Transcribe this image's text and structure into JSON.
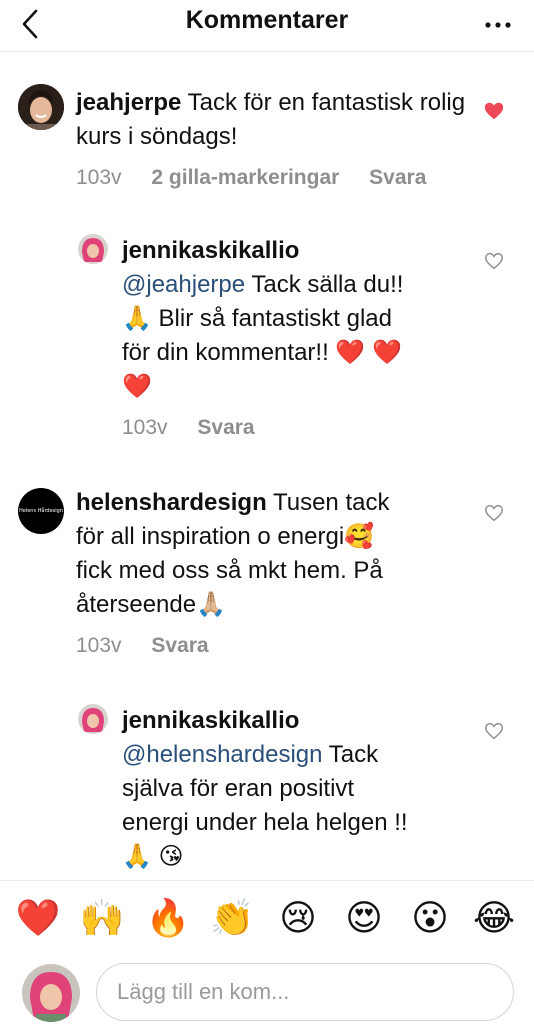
{
  "header": {
    "title": "Kommentarer",
    "back_icon": "chevron-left-icon",
    "more_icon": "more-horizontal-icon"
  },
  "comments": [
    {
      "username": "jeahjerpe",
      "text": "Tack för en fantastisk rolig kurs i söndags!",
      "age": "103v",
      "likes": "2 gilla-markeringar",
      "reply": "Svara",
      "liked": true
    },
    {
      "username": "jennikaskikallio",
      "mention": "@jeahjerpe",
      "text_line1": "Tack sälla du!!",
      "text_line2": "🙏 Blir så fantastiskt glad",
      "text_line3": "för din kommentar!! ❤️ ❤️",
      "text_line4": "❤️",
      "age": "103v",
      "reply": "Svara",
      "liked": false
    },
    {
      "username": "helenshardesign",
      "avatar_text": "Helens Hårdesign",
      "text_line1": "Tusen tack",
      "text_line2": "för all inspiration o energi🥰",
      "text_line3": "fick med oss så mkt hem. På",
      "text_line4": "återseende🙏🏼",
      "age": "103v",
      "reply": "Svara",
      "liked": false
    },
    {
      "username": "jennikaskikallio",
      "mention": "@helenshardesign",
      "text_line1": "Tack",
      "text_line2": "själva för eran positivt",
      "text_line3": "energi under hela helgen !!",
      "text_line4": "🙏 😘",
      "liked": false
    }
  ],
  "emoji_bar": [
    "❤️",
    "🙌",
    "🔥",
    "👏",
    "😢",
    "😍",
    "😮",
    "😂"
  ],
  "compose": {
    "placeholder": "Lägg till en kom..."
  },
  "colors": {
    "heart_active": "#ed4956",
    "mention": "#2a4f7a",
    "meta": "#8e8e8e"
  }
}
